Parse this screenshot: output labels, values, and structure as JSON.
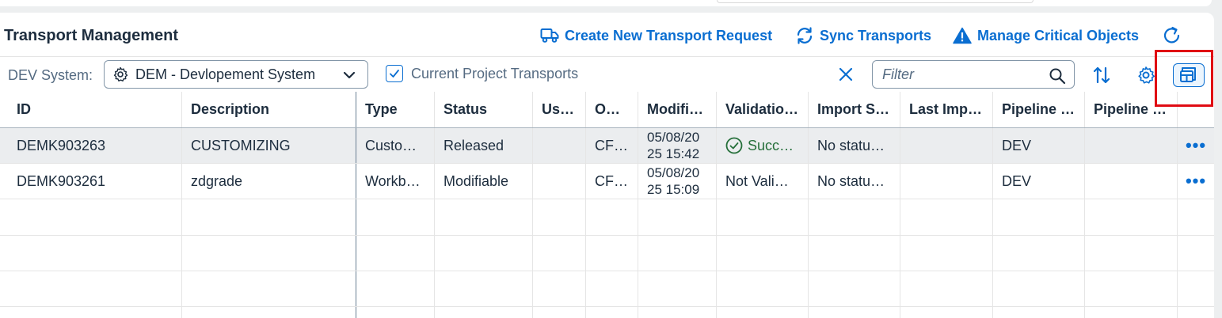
{
  "header": {
    "title": "Transport Management",
    "actions": [
      {
        "label": "Create New Transport Request",
        "icon": "truck-icon"
      },
      {
        "label": "Sync Transports",
        "icon": "sync-icon"
      },
      {
        "label": "Manage Critical Objects",
        "icon": "warning-icon"
      }
    ],
    "refresh_icon": "refresh-icon"
  },
  "toolbar": {
    "dev_label": "DEV System:",
    "dev_select_value": "DEM - Devlopement System",
    "current_project_label": "Current Project Transports",
    "current_project_checked": true,
    "filter_placeholder": "Filter"
  },
  "table": {
    "columns": [
      "ID",
      "Description",
      "Type",
      "Status",
      "Us…",
      "O…",
      "Modifi…",
      "Validatio…",
      "Import S…",
      "Last Imp…",
      "Pipeline …",
      "Pipeline …"
    ],
    "rows": [
      {
        "id": "DEMK903263",
        "description": "CUSTOMIZING",
        "type": "Custo…",
        "status": "Released",
        "user": "",
        "owner": "CF…",
        "modified_line1": "05/08/20",
        "modified_line2": "25 15:42",
        "validation": "Succ…",
        "import_status": "No statu…",
        "last_import": "",
        "pipeline1": "DEV",
        "pipeline2": "",
        "selected": true
      },
      {
        "id": "DEMK903261",
        "description": "zdgrade",
        "type": "Workb…",
        "status": "Modifiable",
        "user": "",
        "owner": "CF…",
        "modified_line1": "05/08/20",
        "modified_line2": "25 15:09",
        "validation": "Not Vali…",
        "import_status": "No statu…",
        "last_import": "",
        "pipeline1": "DEV",
        "pipeline2": "",
        "selected": false
      }
    ],
    "row_actions_label": "•••"
  },
  "colors": {
    "accent": "#0a6ed1",
    "highlight_border": "#e00b13",
    "success": "#256f3a",
    "text": "#1d2d3e",
    "muted": "#556b82"
  }
}
